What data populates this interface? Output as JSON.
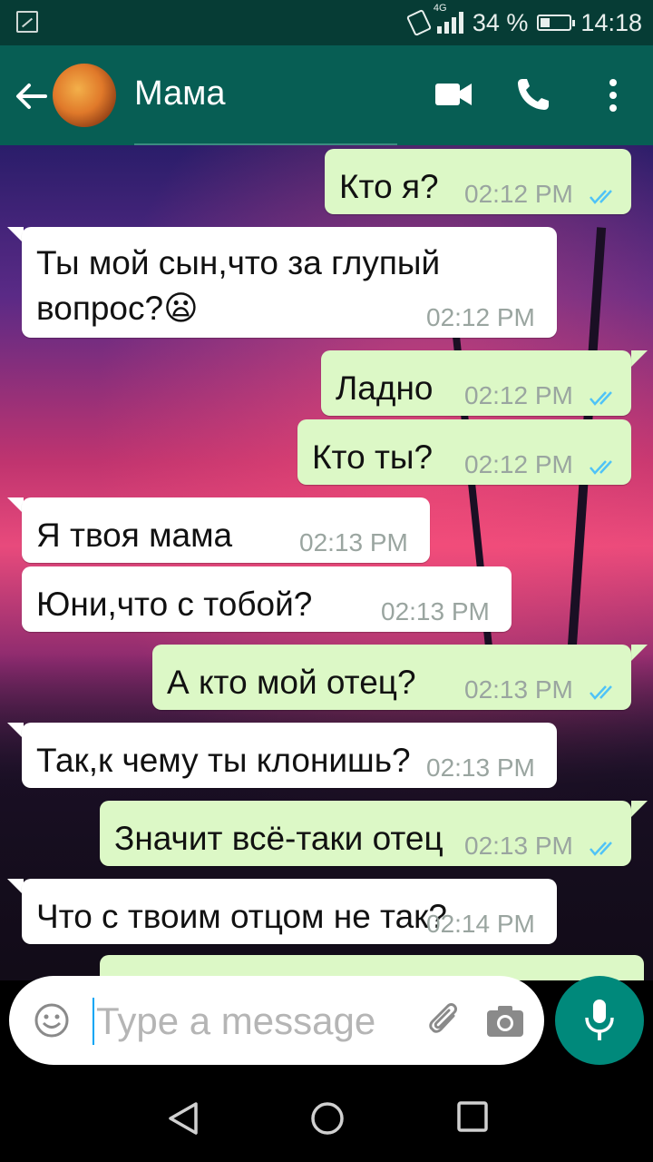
{
  "status_bar": {
    "network": "4G",
    "battery": "34 %",
    "time": "14:18"
  },
  "header": {
    "contact_name": "Мама",
    "icons": [
      "back-arrow-icon",
      "video-call-icon",
      "phone-icon",
      "more-vertical-icon"
    ]
  },
  "messages": [
    {
      "dir": "out",
      "text": "Кто я?",
      "time": "02:12 PM",
      "ticks": "read"
    },
    {
      "dir": "in",
      "text_line1": "Ты мой сын,что за глупый",
      "text_line2": "вопрос?😦",
      "time": "02:12 PM"
    },
    {
      "dir": "out",
      "text": "Ладно",
      "time": "02:12 PM",
      "ticks": "read"
    },
    {
      "dir": "out",
      "text": "Кто ты?",
      "time": "02:12 PM",
      "ticks": "read"
    },
    {
      "dir": "in",
      "text": "Я твоя мама",
      "time": "02:13 PM"
    },
    {
      "dir": "in",
      "text": "Юни,что с тобой?",
      "time": "02:13 PM"
    },
    {
      "dir": "out",
      "text": "А кто мой отец?",
      "time": "02:13 PM",
      "ticks": "read"
    },
    {
      "dir": "in",
      "text": "Так,к чему ты клонишь?",
      "time": "02:13 PM"
    },
    {
      "dir": "out",
      "text": "Значит всё-таки отец",
      "time": "02:13 PM",
      "ticks": "read"
    },
    {
      "dir": "in",
      "text": "Что с твоим отцом не так?",
      "time": "02:14 PM"
    }
  ],
  "input": {
    "placeholder": "Type a message"
  },
  "colors": {
    "header": "#075e54",
    "status_bar": "#063c35",
    "outgoing_bubble": "#dcf8c6",
    "incoming_bubble": "#ffffff",
    "read_ticks": "#4fc3f7",
    "mic_button": "#00897b"
  }
}
